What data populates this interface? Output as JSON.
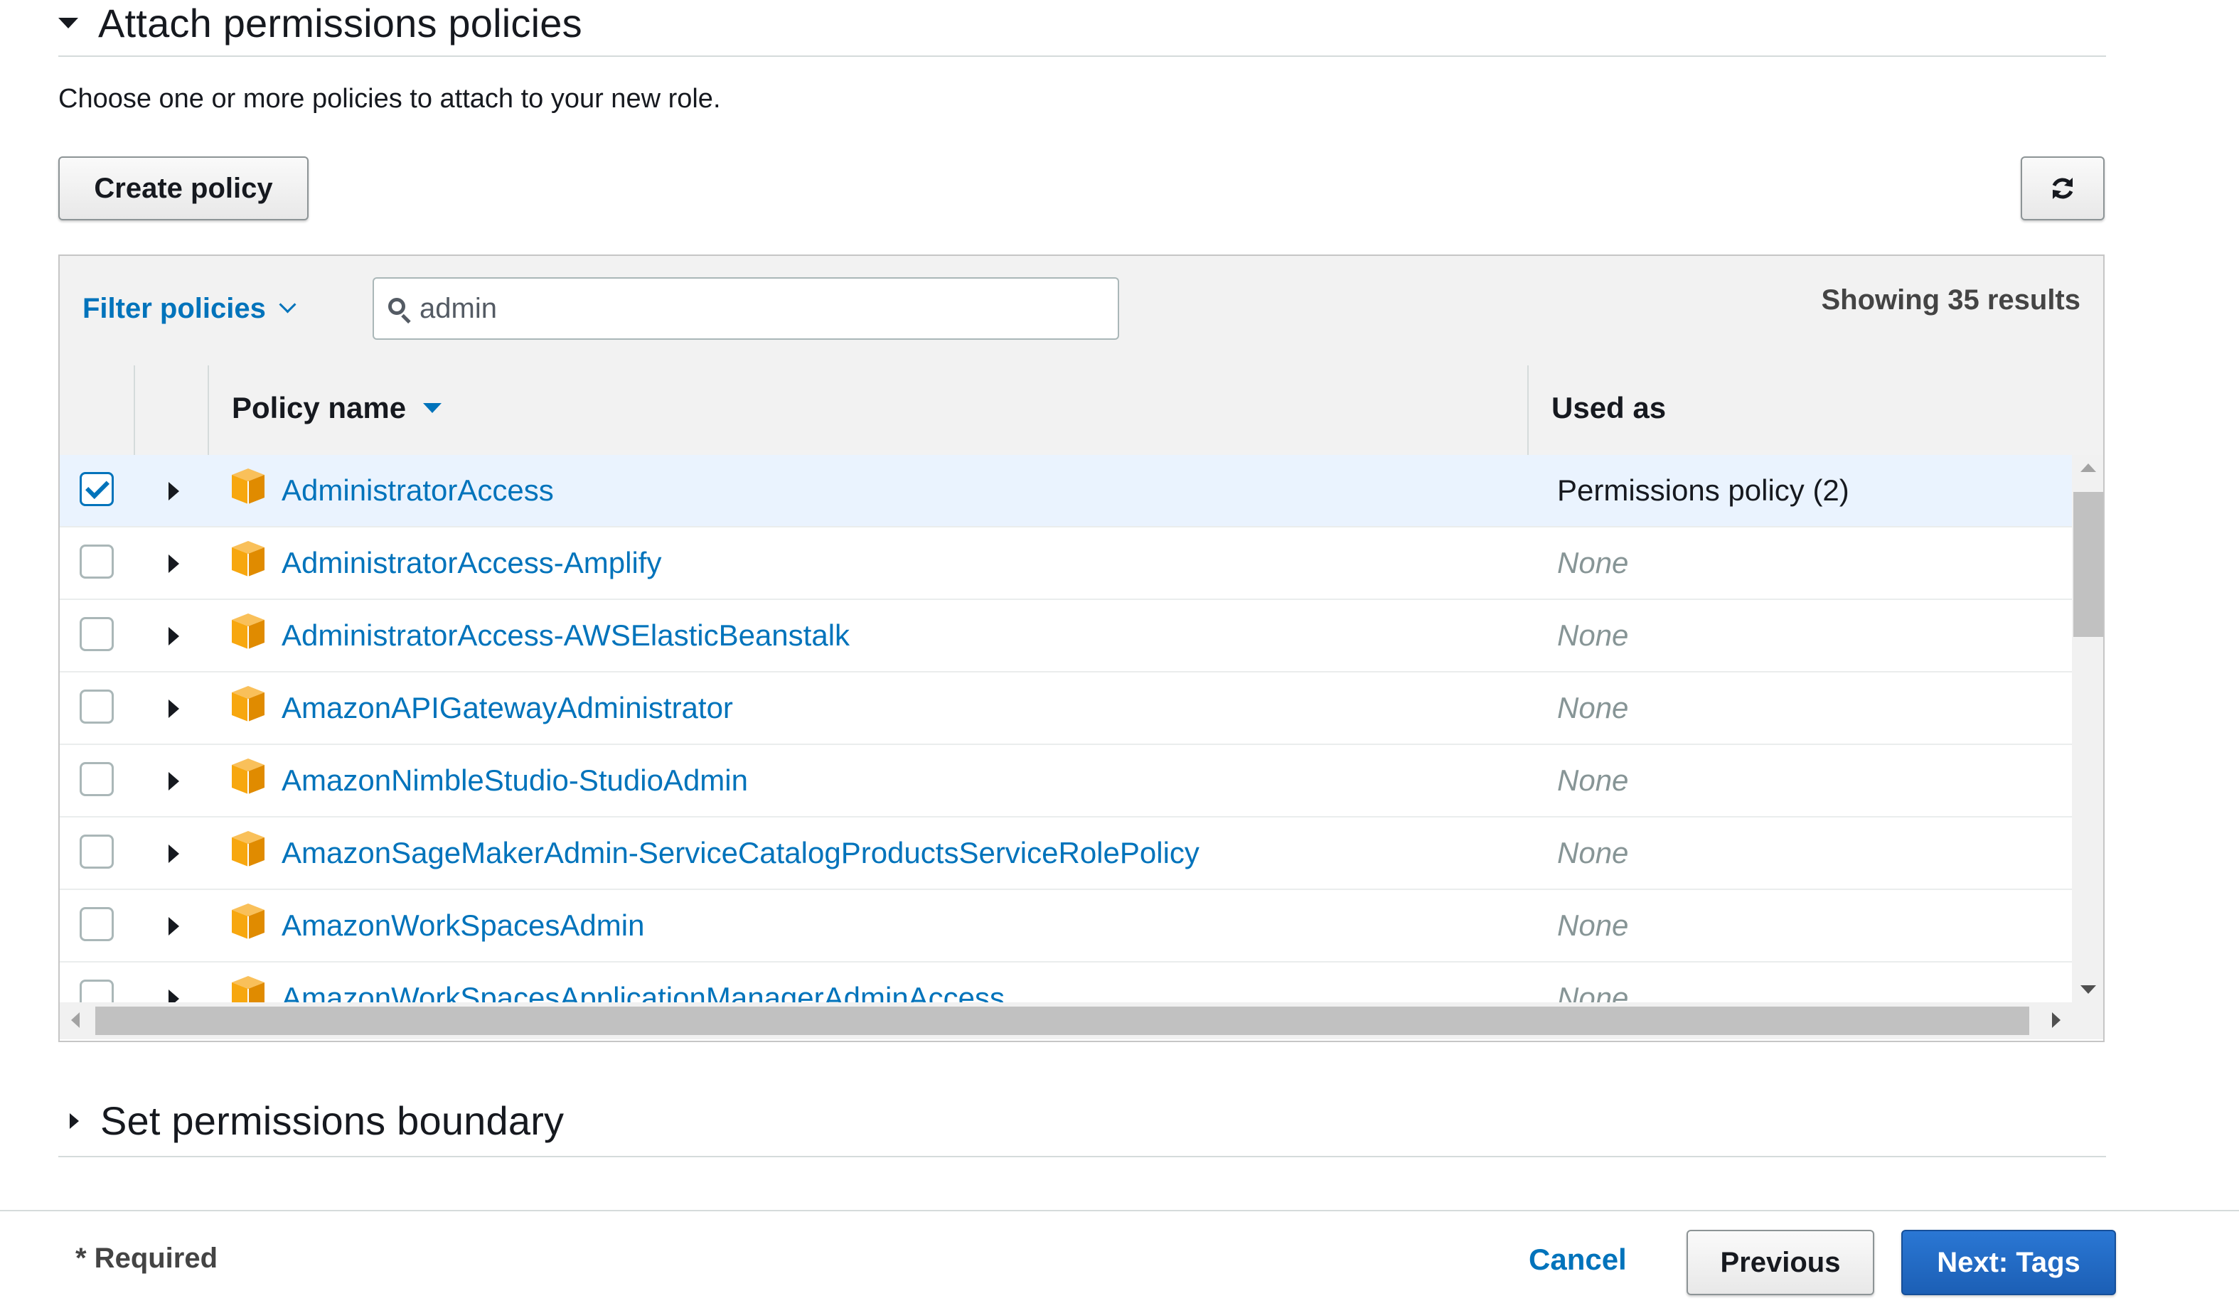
{
  "attach_section": {
    "title": "Attach permissions policies",
    "description": "Choose one or more policies to attach to your new role."
  },
  "toolbar": {
    "create_policy_label": "Create policy",
    "refresh_icon": "refresh-icon"
  },
  "filter": {
    "label": "Filter policies",
    "search_value": "admin",
    "results_text": "Showing 35 results"
  },
  "table": {
    "columns": [
      "Policy name",
      "Used as"
    ],
    "rows": [
      {
        "checked": true,
        "name": "AdministratorAccess",
        "used_as": "Permissions policy (2)"
      },
      {
        "checked": false,
        "name": "AdministratorAccess-Amplify",
        "used_as": "None"
      },
      {
        "checked": false,
        "name": "AdministratorAccess-AWSElasticBeanstalk",
        "used_as": "None"
      },
      {
        "checked": false,
        "name": "AmazonAPIGatewayAdministrator",
        "used_as": "None"
      },
      {
        "checked": false,
        "name": "AmazonNimbleStudio-StudioAdmin",
        "used_as": "None"
      },
      {
        "checked": false,
        "name": "AmazonSageMakerAdmin-ServiceCatalogProductsServiceRolePolicy",
        "used_as": "None"
      },
      {
        "checked": false,
        "name": "AmazonWorkSpacesAdmin",
        "used_as": "None"
      },
      {
        "checked": false,
        "name": "AmazonWorkSpacesApplicationManagerAdminAccess",
        "used_as": "None"
      }
    ]
  },
  "boundary_section": {
    "title": "Set permissions boundary"
  },
  "footer": {
    "required_label": "* Required",
    "cancel_label": "Cancel",
    "previous_label": "Previous",
    "next_label": "Next: Tags"
  },
  "colors": {
    "link": "#0073bb",
    "policy_icon": "#f7a70f",
    "primary_button": "#2a77d4",
    "selected_row": "#eaf3fe"
  }
}
